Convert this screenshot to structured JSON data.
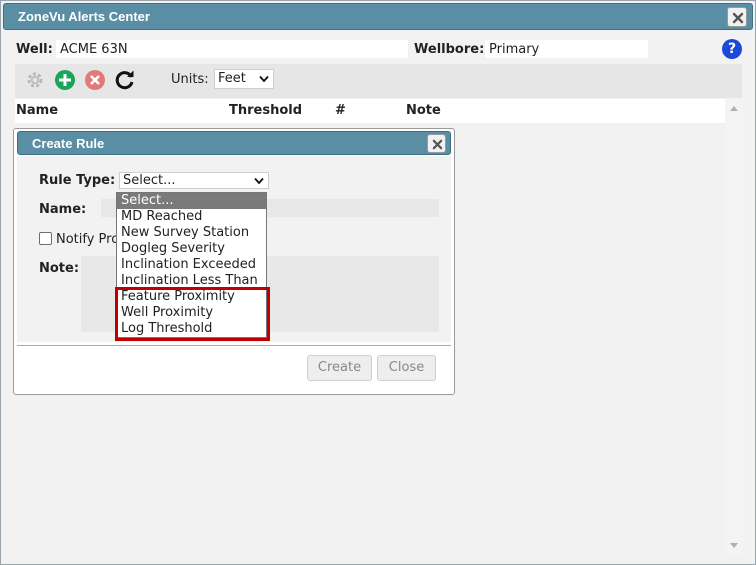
{
  "window": {
    "title": "ZoneVu Alerts Center"
  },
  "well": {
    "label": "Well:",
    "value": "ACME 63N"
  },
  "wellbore": {
    "label": "Wellbore:",
    "value": "Primary"
  },
  "help_symbol": "?",
  "toolbar": {
    "units_label": "Units:",
    "units_value": "Feet"
  },
  "table": {
    "columns": [
      "Name",
      "Threshold",
      "#",
      "Note"
    ]
  },
  "dialog": {
    "title": "Create Rule",
    "rule_type_label": "Rule Type:",
    "rule_type_value": "Select...",
    "name_label": "Name:",
    "notify_label": "Notify Pro",
    "note_label": "Note:",
    "create_button": "Create",
    "close_button": "Close"
  },
  "dropdown": {
    "options": [
      "Select...",
      "MD Reached",
      "New Survey Station",
      "Dogleg Severity",
      "Inclination Exceeded",
      "Inclination Less Than",
      "Feature Proximity",
      "Well Proximity",
      "Log Threshold"
    ],
    "selected_index": 0
  },
  "colors": {
    "titlebar": "#5a8ea4",
    "highlight": "#c00000",
    "add": "#1aa55a",
    "remove": "#e27a7a",
    "help": "#1c49d8"
  }
}
